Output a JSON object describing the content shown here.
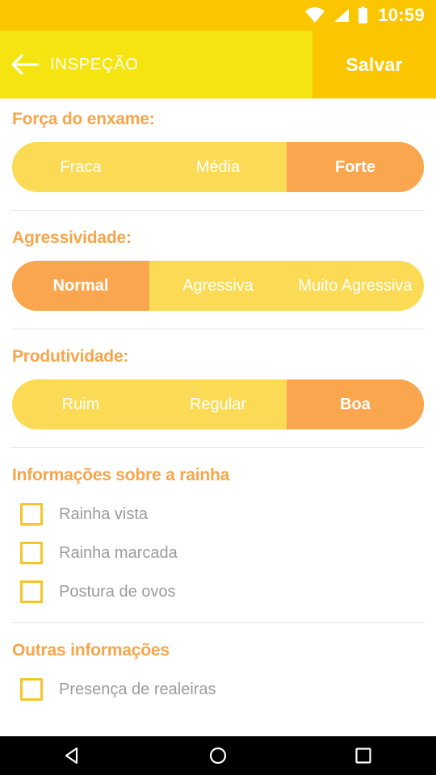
{
  "status_bar": {
    "time": "10:59",
    "icons": [
      "wifi-icon",
      "signal-icon",
      "battery-icon"
    ],
    "background": "#FBC600"
  },
  "toolbar": {
    "back_icon": "back-arrow-icon",
    "title": "INSPEÇÃO",
    "save_label": "Salvar",
    "left_background": "#F6E410",
    "right_background": "#FBC600"
  },
  "theme": {
    "label_color": "#F6A54B",
    "segment_unselected": "#FBDB55",
    "segment_selected": "#F9A64F",
    "checkbox_border": "#F7C52B",
    "checkbox_label": "#9B9B9B",
    "divider": "#E4E4E4"
  },
  "sections": [
    {
      "label": "Força do enxame:",
      "type": "segmented",
      "options": [
        "Fraca",
        "Média",
        "Forte"
      ],
      "selected": "Forte"
    },
    {
      "label": "Agressividade:",
      "type": "segmented",
      "options": [
        "Normal",
        "Agressiva",
        "Muito Agressiva"
      ],
      "selected": "Normal"
    },
    {
      "label": "Produtividade:",
      "type": "segmented",
      "options": [
        "Ruim",
        "Regular",
        "Boa"
      ],
      "selected": "Boa"
    },
    {
      "label": "Informações sobre a rainha",
      "type": "checkboxes",
      "items": [
        {
          "label": "Rainha vista",
          "checked": false
        },
        {
          "label": "Rainha marcada",
          "checked": false
        },
        {
          "label": "Postura de ovos",
          "checked": false
        }
      ]
    },
    {
      "label": "Outras informações",
      "type": "checkboxes",
      "items": [
        {
          "label": "Presença de realeiras",
          "checked": false
        }
      ]
    }
  ],
  "nav_bar": {
    "back": "nav-back-icon",
    "home": "nav-home-icon",
    "recents": "nav-recents-icon",
    "background": "#000000"
  }
}
